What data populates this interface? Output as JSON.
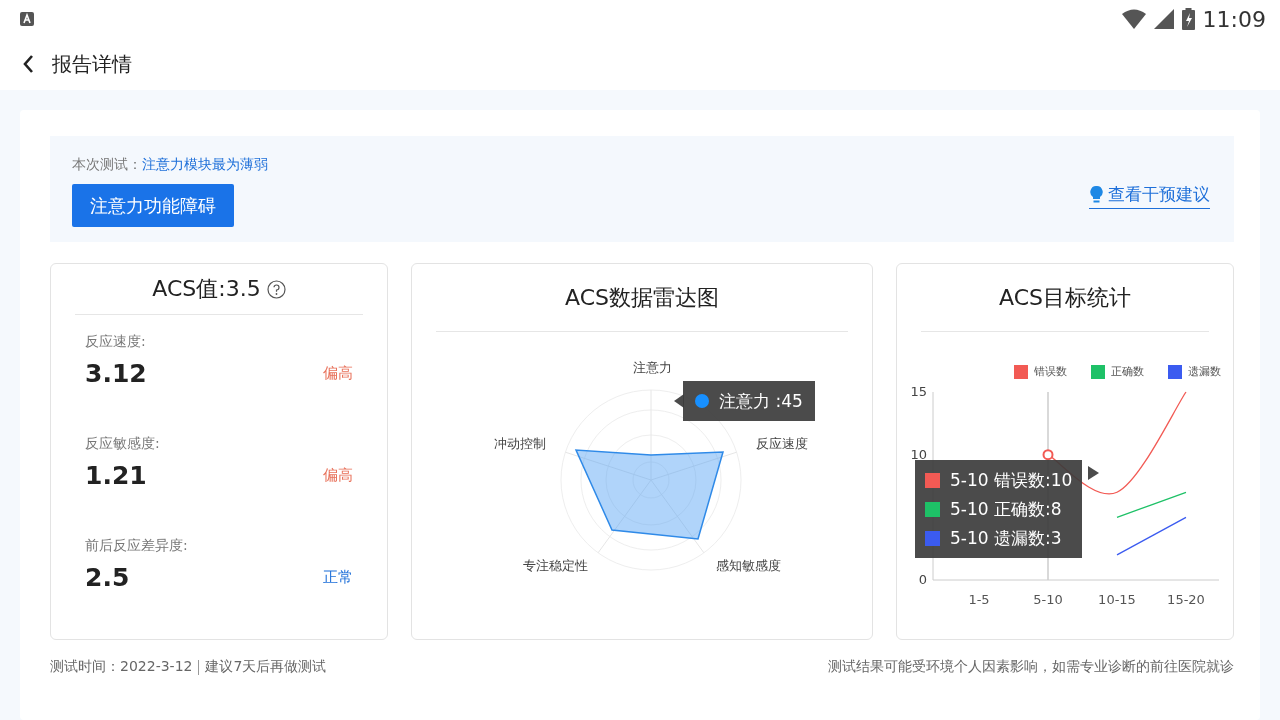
{
  "status_bar": {
    "time": "11:09"
  },
  "header": {
    "title": "报告详情"
  },
  "summary": {
    "label": "本次测试：",
    "highlight": "注意力模块最为薄弱",
    "tag": "注意力功能障碍",
    "link": "查看干预建议"
  },
  "score_card": {
    "title": "ACS值:3.5",
    "metrics": [
      {
        "label": "反应速度:",
        "value": "3.12",
        "status": "偏高",
        "kind": "high"
      },
      {
        "label": "反应敏感度:",
        "value": "1.21",
        "status": "偏高",
        "kind": "high"
      },
      {
        "label": "前后反应差异度:",
        "value": "2.5",
        "status": "正常",
        "kind": "normal"
      }
    ]
  },
  "radar_card": {
    "title": "ACS数据雷达图",
    "indicators": [
      "注意力",
      "反应速度",
      "感知敏感度",
      "专注稳定性",
      "冲动控制"
    ],
    "tooltip": {
      "text": "注意力 :45",
      "color": "#1890ff"
    }
  },
  "stats_card": {
    "title": "ACS目标统计",
    "chart_data": {
      "type": "line",
      "categories": [
        "1-5",
        "5-10",
        "10-15",
        "15-20"
      ],
      "yticks": [
        0,
        10,
        15
      ],
      "ylim": [
        0,
        15
      ],
      "legend": "top",
      "series": [
        {
          "name": "错误数",
          "color": "#f25a54",
          "values": [
            null,
            10,
            7,
            15
          ]
        },
        {
          "name": "正确数",
          "color": "#1ec167",
          "values": [
            null,
            null,
            5,
            7
          ]
        },
        {
          "name": "遗漏数",
          "color": "#3b5bf0",
          "values": [
            null,
            null,
            2,
            5
          ]
        }
      ]
    },
    "tooltip": {
      "rows": [
        {
          "text": "5-10 错误数:10",
          "color": "#f25a54"
        },
        {
          "text": "5-10 正确数:8",
          "color": "#1ec167"
        },
        {
          "text": "5-10 遗漏数:3",
          "color": "#3b5bf0"
        }
      ]
    }
  },
  "footer": {
    "date": "测试时间：2022-3-12",
    "advice": "建议7天后再做测试",
    "disclaimer": "测试结果可能受环境个人因素影响，如需专业诊断的前往医院就诊"
  }
}
